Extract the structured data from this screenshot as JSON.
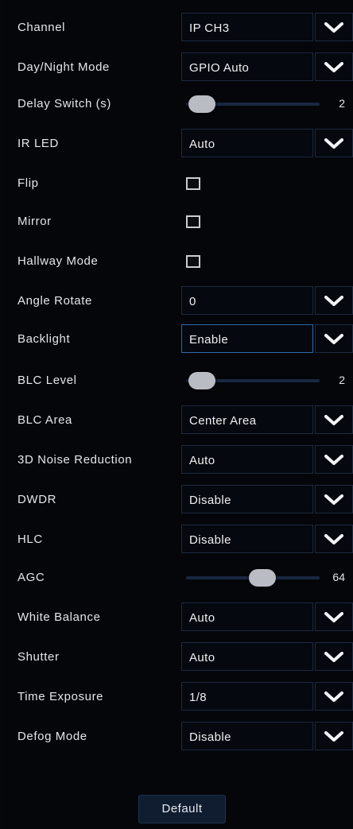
{
  "rows": [
    {
      "label": "Channel",
      "type": "select",
      "value": "IP CH3"
    },
    {
      "label": "Day/Night Mode",
      "type": "select",
      "value": "GPIO Auto"
    },
    {
      "label": "Delay Switch (s)",
      "type": "slider",
      "value": "2",
      "level": 0.05
    },
    {
      "label": "IR LED",
      "type": "select",
      "value": "Auto"
    },
    {
      "label": "Flip",
      "type": "checkbox",
      "checked": false
    },
    {
      "label": "Mirror",
      "type": "checkbox",
      "checked": false
    },
    {
      "label": "Hallway Mode",
      "type": "checkbox",
      "checked": false
    },
    {
      "label": "Angle Rotate",
      "type": "select",
      "value": "0"
    },
    {
      "label": "Backlight",
      "type": "select",
      "value": "Enable",
      "active": true
    },
    {
      "label": "BLC Level",
      "type": "slider",
      "value": "2",
      "level": 0.05
    },
    {
      "label": "BLC Area",
      "type": "select",
      "value": "Center Area"
    },
    {
      "label": "3D Noise Reduction",
      "type": "select",
      "value": "Auto"
    },
    {
      "label": "DWDR",
      "type": "select",
      "value": "Disable"
    },
    {
      "label": "HLC",
      "type": "select",
      "value": "Disable"
    },
    {
      "label": "AGC",
      "type": "slider",
      "value": "64",
      "level": 0.5
    },
    {
      "label": "White Balance",
      "type": "select",
      "value": "Auto"
    },
    {
      "label": "Shutter",
      "type": "select",
      "value": "Auto"
    },
    {
      "label": "Time Exposure",
      "type": "select",
      "value": "1/8"
    },
    {
      "label": "Defog Mode",
      "type": "select",
      "value": "Disable"
    }
  ],
  "default_button": "Default",
  "icons": {
    "dropdown": "chevron-down-icon"
  }
}
